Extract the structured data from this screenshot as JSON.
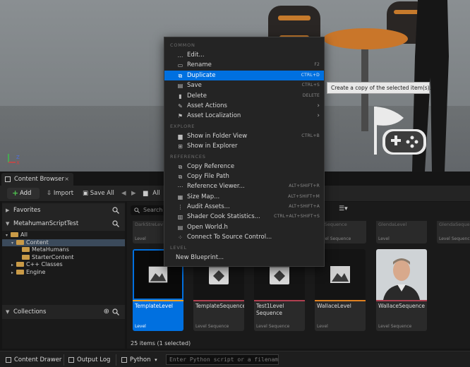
{
  "menu": {
    "sections": {
      "common": "COMMON",
      "explore": "EXPLORE",
      "references": "REFERENCES",
      "level": "LEVEL"
    },
    "common_items": [
      {
        "label": "Edit...",
        "shortcut": "",
        "icon": "edit-icon"
      },
      {
        "label": "Rename",
        "shortcut": "F2",
        "icon": "rename-icon"
      },
      {
        "label": "Duplicate",
        "shortcut": "CTRL+D",
        "icon": "duplicate-icon",
        "highlighted": true
      },
      {
        "label": "Save",
        "shortcut": "CTRL+S",
        "icon": "save-icon"
      },
      {
        "label": "Delete",
        "shortcut": "DELETE",
        "icon": "delete-icon"
      },
      {
        "label": "Asset Actions",
        "shortcut": "",
        "icon": "wrench-icon",
        "submenu": true
      },
      {
        "label": "Asset Localization",
        "shortcut": "",
        "icon": "flag-icon",
        "submenu": true
      }
    ],
    "explore_items": [
      {
        "label": "Show in Folder View",
        "shortcut": "CTRL+B",
        "icon": "folder-icon"
      },
      {
        "label": "Show in Explorer",
        "shortcut": "",
        "icon": "explorer-icon"
      }
    ],
    "reference_items": [
      {
        "label": "Copy Reference",
        "shortcut": "",
        "icon": "copy-icon"
      },
      {
        "label": "Copy File Path",
        "shortcut": "",
        "icon": "copy-path-icon"
      },
      {
        "label": "Reference Viewer...",
        "shortcut": "ALT+SHIFT+R",
        "icon": "reference-viewer-icon"
      },
      {
        "label": "Size Map...",
        "shortcut": "ALT+SHIFT+M",
        "icon": "size-map-icon"
      },
      {
        "label": "Audit Assets...",
        "shortcut": "ALT+SHIFT+A",
        "icon": "audit-icon"
      },
      {
        "label": "Shader Cook Statistics...",
        "shortcut": "CTRL+ALT+SHIFT+S",
        "icon": "shader-stats-icon"
      },
      {
        "label": "Open World.h",
        "shortcut": "",
        "icon": "code-icon"
      },
      {
        "label": "Connect To Source Control...",
        "shortcut": "",
        "icon": "source-control-icon"
      }
    ],
    "level_items": [
      {
        "label": "New Blueprint...",
        "shortcut": ""
      }
    ]
  },
  "tooltip": "Create a copy of the selected item(s).",
  "content_browser": {
    "tab_label": "Content Browser",
    "tab_close": "×",
    "add_label": "Add",
    "import_label": "Import",
    "save_all_label": "Save All",
    "path_all": "All",
    "search_placeholder": "Search",
    "favorites_label": "Favorites",
    "project_label": "MetahumanScriptTest",
    "collections_label": "Collections",
    "tree": [
      {
        "label": "All",
        "indent": 0,
        "caret": "▾"
      },
      {
        "label": "Content",
        "indent": 1,
        "caret": "▾",
        "selected": true
      },
      {
        "label": "MetaHumans",
        "indent": 2,
        "caret": ""
      },
      {
        "label": "StarterContent",
        "indent": 2,
        "caret": ""
      },
      {
        "label": "C++ Classes",
        "indent": 1,
        "caret": "▸"
      },
      {
        "label": "Engine",
        "indent": 1,
        "caret": "▸"
      }
    ],
    "top_tiles": [
      {
        "name": "DarkStreLev",
        "type": "Level"
      },
      {
        "name": "ArtSequence",
        "type": "Level Sequence"
      },
      {
        "name": "GlendaLevel",
        "type": "Level"
      },
      {
        "name": "GlendaSequence",
        "type": "Level Sequence"
      }
    ],
    "tiles": [
      {
        "name": "TemplateLevel",
        "type": "Level",
        "kind": "level",
        "selected": true,
        "bar_color": "#f0a020"
      },
      {
        "name": "TemplateSequence",
        "type": "Level Sequence",
        "kind": "sequence",
        "bar_color": "#b04050"
      },
      {
        "name": "Test1Level Sequence",
        "type": "Level Sequence",
        "kind": "sequence",
        "bar_color": "#b04050"
      },
      {
        "name": "WallaceLevel",
        "type": "Level",
        "kind": "level",
        "bar_color": "#e08020"
      },
      {
        "name": "WallaceSequence",
        "type": "Level Sequence",
        "kind": "photo",
        "bar_color": "#b04050"
      }
    ],
    "items_count": "25 items (1 selected)"
  },
  "statusbar": {
    "content_drawer": "Content Drawer",
    "output_log": "Output Log",
    "python": "Python",
    "python_placeholder": "Enter Python script or a filename"
  },
  "colors": {
    "accent": "#0070e0",
    "add_plus": "#4fc04f",
    "folder": "#c99a47"
  }
}
